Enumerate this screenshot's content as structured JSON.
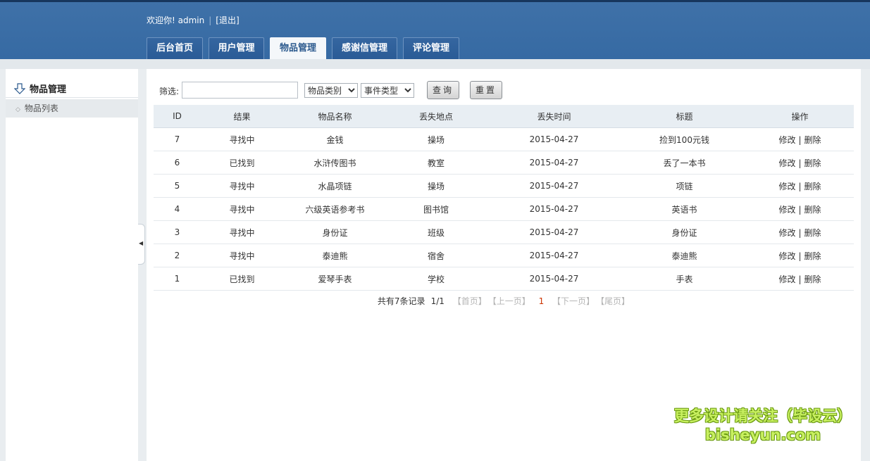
{
  "header": {
    "welcome": "欢迎你!",
    "username": "admin",
    "logout": "[退出]",
    "tabs": [
      {
        "label": "后台首页"
      },
      {
        "label": "用户管理"
      },
      {
        "label": "物品管理"
      },
      {
        "label": "感谢信管理"
      },
      {
        "label": "评论管理"
      }
    ],
    "active_tab": "物品管理"
  },
  "sidebar": {
    "title": "物品管理",
    "items": [
      {
        "label": "物品列表"
      }
    ]
  },
  "filter": {
    "label": "筛选:",
    "input_value": "",
    "category_select": "物品类别",
    "event_select": "事件类型",
    "query_button": "查询",
    "reset_button": "重置"
  },
  "table": {
    "columns": [
      "ID",
      "结果",
      "物品名称",
      "丢失地点",
      "丢失时间",
      "标题",
      "操作"
    ],
    "rows": [
      {
        "id": "7",
        "result": "寻找中",
        "name": "金钱",
        "place": "操场",
        "time": "2015-04-27",
        "title": "捡到100元钱"
      },
      {
        "id": "6",
        "result": "已找到",
        "name": "水浒传图书",
        "place": "教室",
        "time": "2015-04-27",
        "title": "丢了一本书"
      },
      {
        "id": "5",
        "result": "寻找中",
        "name": "水晶项链",
        "place": "操场",
        "time": "2015-04-27",
        "title": "项链"
      },
      {
        "id": "4",
        "result": "寻找中",
        "name": "六级英语参考书",
        "place": "图书馆",
        "time": "2015-04-27",
        "title": "英语书"
      },
      {
        "id": "3",
        "result": "寻找中",
        "name": "身份证",
        "place": "班级",
        "time": "2015-04-27",
        "title": "身份证"
      },
      {
        "id": "2",
        "result": "寻找中",
        "name": "泰迪熊",
        "place": "宿舍",
        "time": "2015-04-27",
        "title": "泰迪熊"
      },
      {
        "id": "1",
        "result": "已找到",
        "name": "爱琴手表",
        "place": "学校",
        "time": "2015-04-27",
        "title": "手表"
      }
    ],
    "op_edit": "修改",
    "op_sep": "|",
    "op_delete": "删除"
  },
  "pager": {
    "summary": "共有7条记录",
    "pages": "1/1",
    "first": "【首页】",
    "prev": "【上一页】",
    "current": "1",
    "next": "【下一页】",
    "last": "【尾页】"
  },
  "watermark": {
    "line1": "更多设计请关注（毕设云）",
    "line2": "bisheyun.com"
  }
}
